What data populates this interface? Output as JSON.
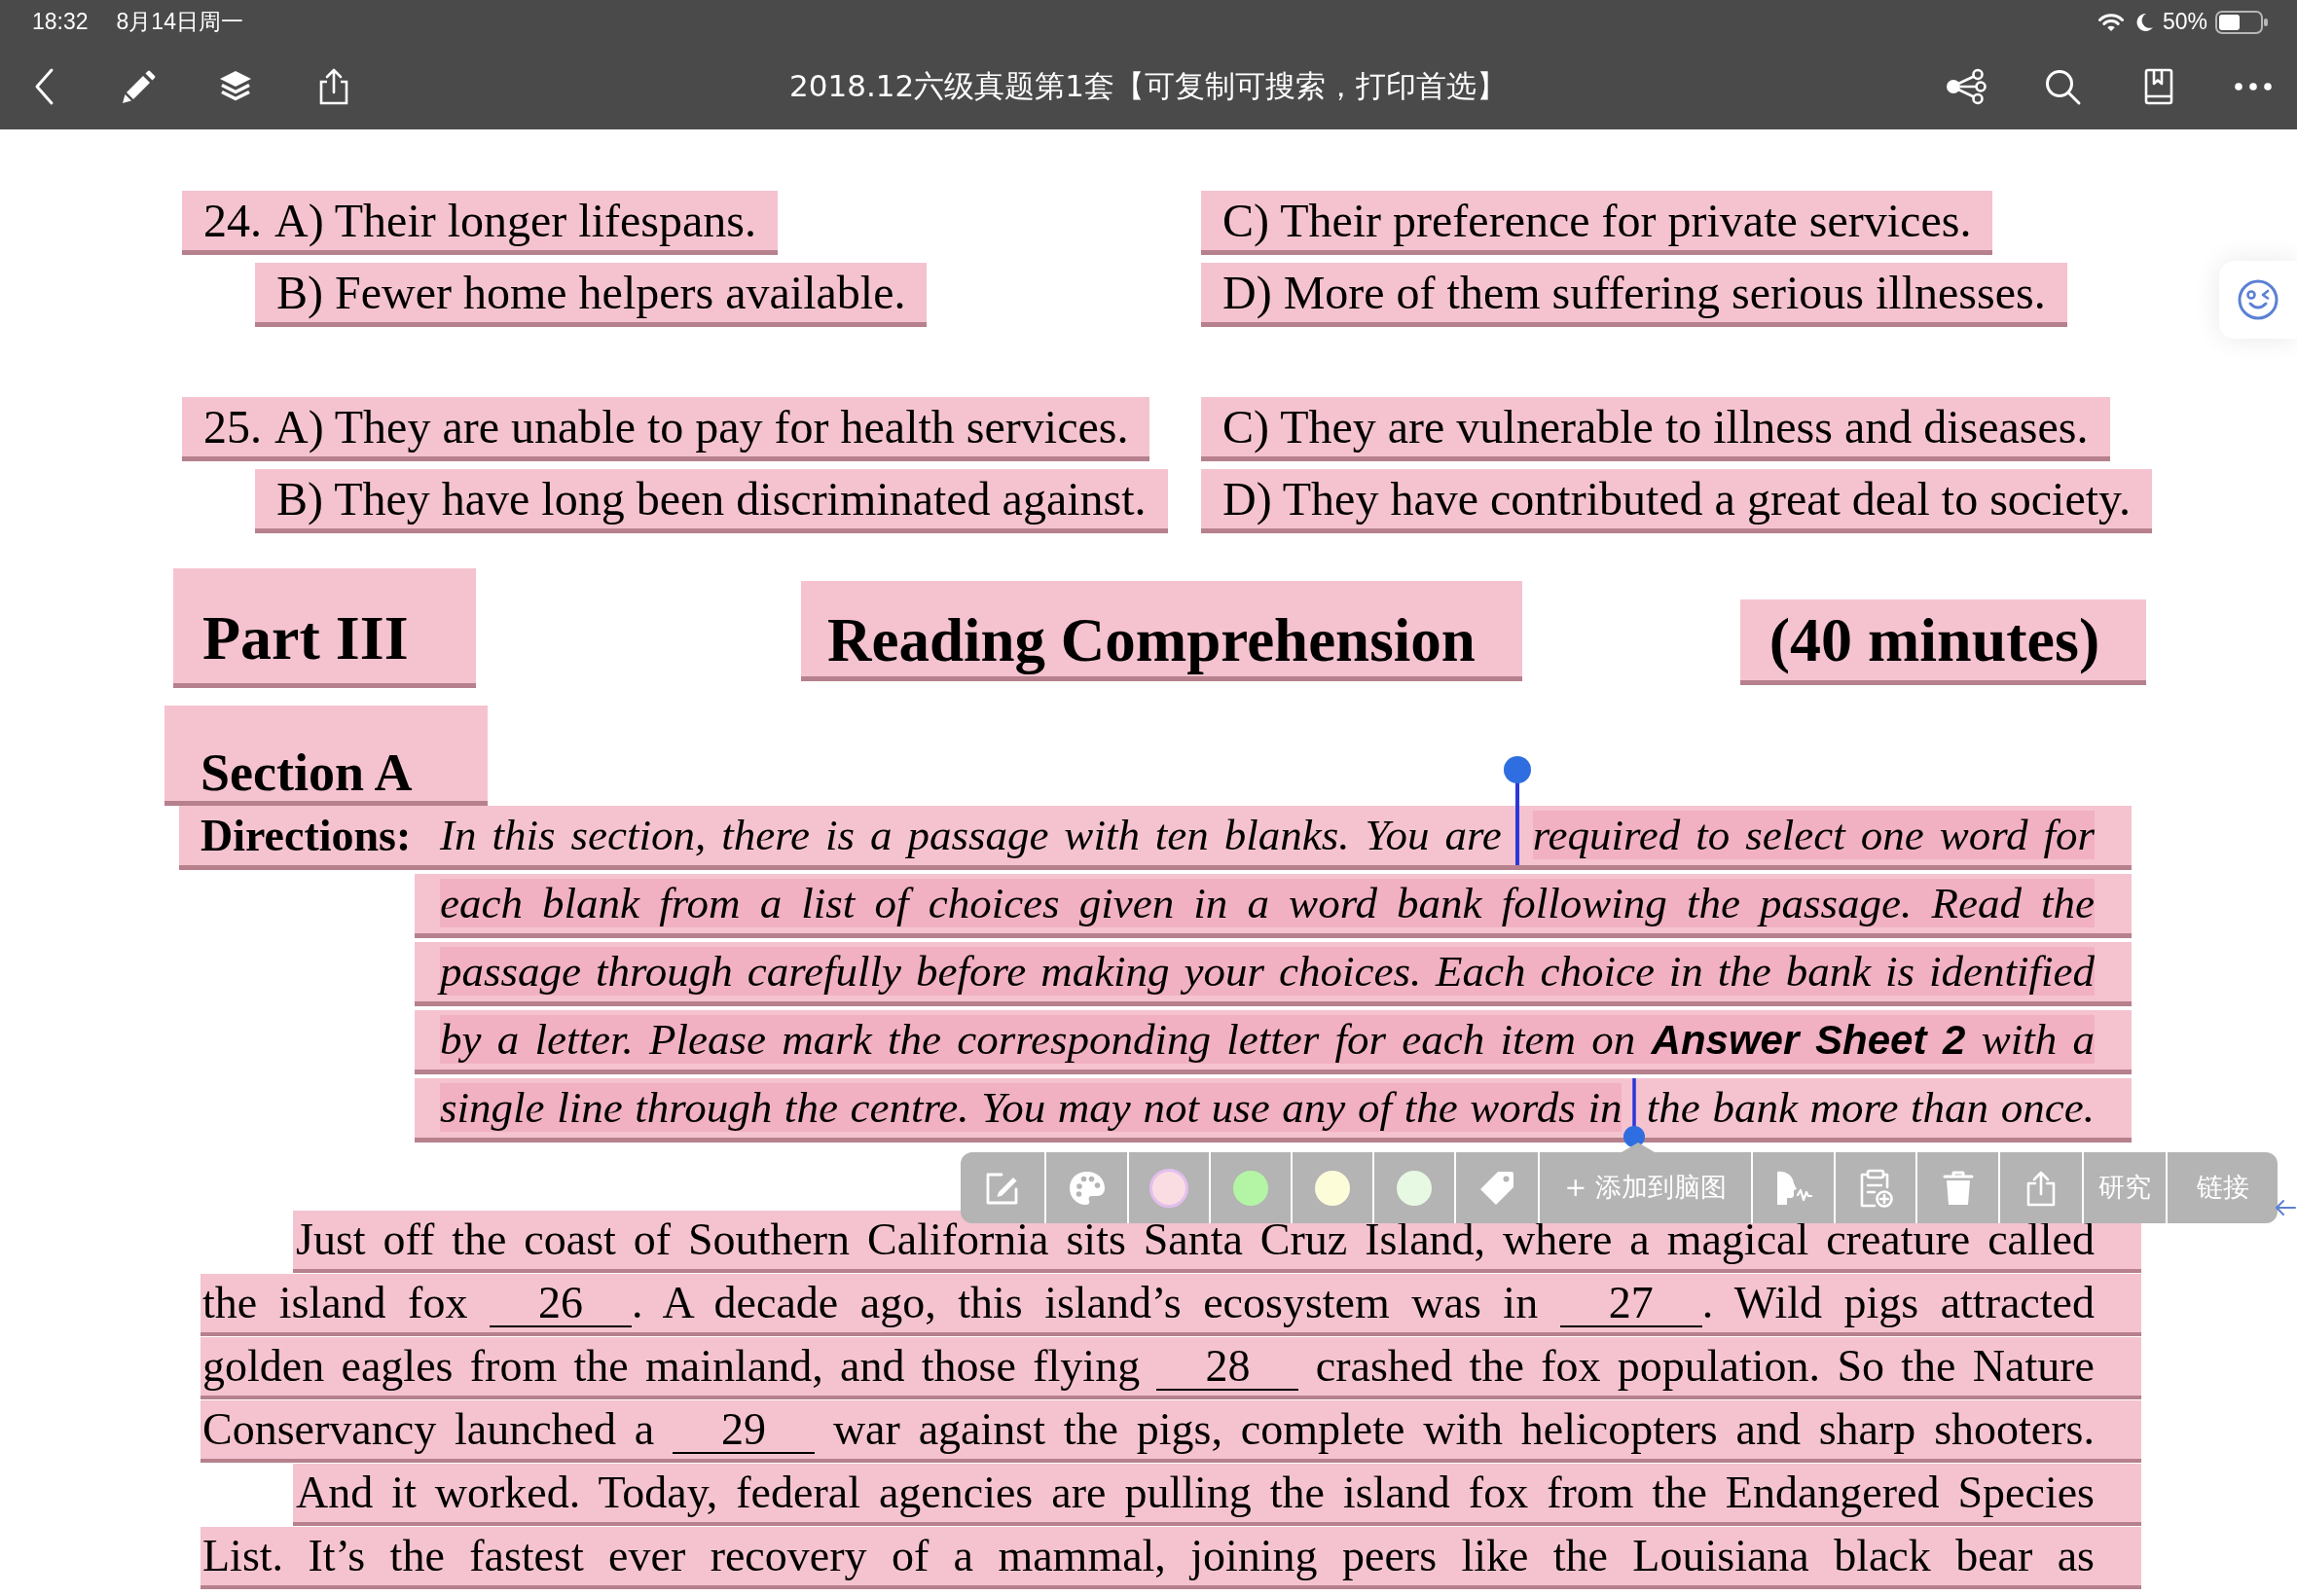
{
  "status_bar": {
    "time": "18:32",
    "date": "8月14日周一",
    "battery": "50%"
  },
  "toolbar": {
    "title": "2018.12六级真题第1套【可复制可搜索，打印首选】"
  },
  "questions": [
    {
      "number": "24.",
      "options": [
        "A) Their longer lifespans.",
        "C) Their preference for private services.",
        "B) Fewer home helpers available.",
        "D) More of them suffering serious illnesses."
      ]
    },
    {
      "number": "25.",
      "options": [
        "A) They are unable to pay for health services.",
        "C) They are vulnerable to illness and diseases.",
        "B) They have long been discriminated against.",
        "D) They have contributed a great deal to society."
      ]
    }
  ],
  "part_header": {
    "part": "Part III",
    "title": "Reading Comprehension",
    "time": "(40 minutes)"
  },
  "section": {
    "title": "Section A"
  },
  "directions": {
    "label": "Directions:",
    "lines": [
      [
        {
          "text": "In this section, there is a passage with ten blanks. You are",
          "selected": false
        },
        {
          "text": "required to select one word for",
          "selected": true
        }
      ],
      [
        {
          "text": "each blank from a list of choices given in a word bank following the passage. Read the",
          "selected": true
        }
      ],
      [
        {
          "text": "passage through carefully before making your choices. Each choice in the bank is identified",
          "selected": true
        }
      ],
      [
        {
          "text": "by a letter. Please mark the corresponding letter for each item on **Answer Sheet 2** with a",
          "selected": true
        }
      ],
      [
        {
          "text": "single line through the centre. You may not use any of the words in",
          "selected": true
        },
        {
          "text": "the bank more than once.",
          "selected": false
        }
      ]
    ]
  },
  "passage": {
    "paragraphs": [
      {
        "lines": [
          [
            {
              "kind": "text",
              "text": "Just off the coast of Southern California sits Santa Cruz Island, where a magical creature called"
            }
          ],
          [
            {
              "kind": "text",
              "text": "the island fox "
            },
            {
              "kind": "blank",
              "text": "26"
            },
            {
              "kind": "text",
              "text": ". A decade ago, this island’s ecosystem was in "
            },
            {
              "kind": "blank",
              "text": "27"
            },
            {
              "kind": "text",
              "text": ". Wild pigs attracted"
            }
          ],
          [
            {
              "kind": "text",
              "text": "golden eagles from the mainland, and those flying "
            },
            {
              "kind": "blank",
              "text": "28"
            },
            {
              "kind": "text",
              "text": " crashed the fox population. So the Nature"
            }
          ],
          [
            {
              "kind": "text",
              "text": "Conservancy launched a "
            },
            {
              "kind": "blank",
              "text": "29"
            },
            {
              "kind": "text",
              "text": " war against the pigs, complete with helicopters and sharp shooters."
            }
          ]
        ]
      },
      {
        "lines": [
          [
            {
              "kind": "text",
              "text": "And it worked. Today, federal agencies are pulling the island fox from the Endangered Species"
            }
          ],
          [
            {
              "kind": "text",
              "text": "List. It’s the fastest ever recovery of a mammal, joining peers like the Louisiana black bear as"
            }
          ]
        ]
      }
    ]
  },
  "popup": {
    "colors": [
      {
        "color": "#f9dde3",
        "selected": true
      },
      {
        "color": "#b3f5a5",
        "selected": false
      },
      {
        "color": "#fdfcd9",
        "selected": false
      },
      {
        "color": "#e7f9e3",
        "selected": false
      }
    ],
    "mindmap_label": "+ 添加到脑图",
    "research_label": "研究",
    "link_label": "链接"
  }
}
